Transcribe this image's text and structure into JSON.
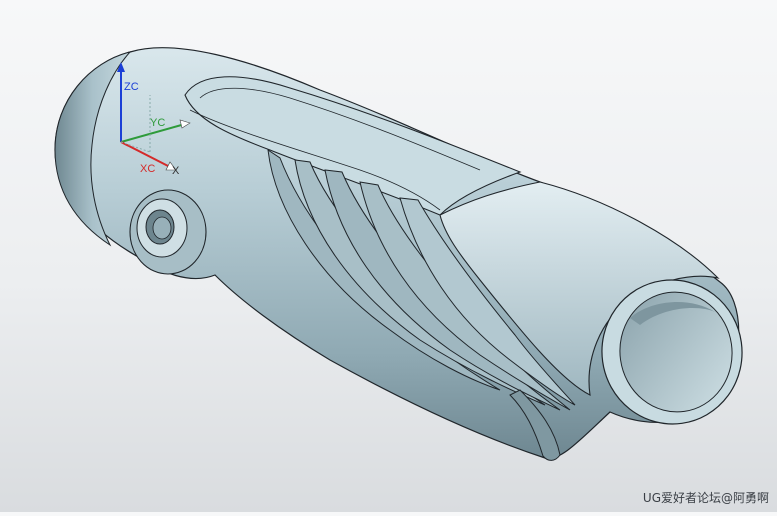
{
  "triad": {
    "zc": "ZC",
    "yc": "YC",
    "xc": "XC",
    "x": "X",
    "colors": {
      "z": "#1b3fd6",
      "y": "#2e9b3a",
      "x": "#d42a2a"
    }
  },
  "watermark": "UG爱好者论坛@阿勇啊",
  "model": {
    "shade": "#b9cfd7",
    "edge": "#20262b"
  }
}
